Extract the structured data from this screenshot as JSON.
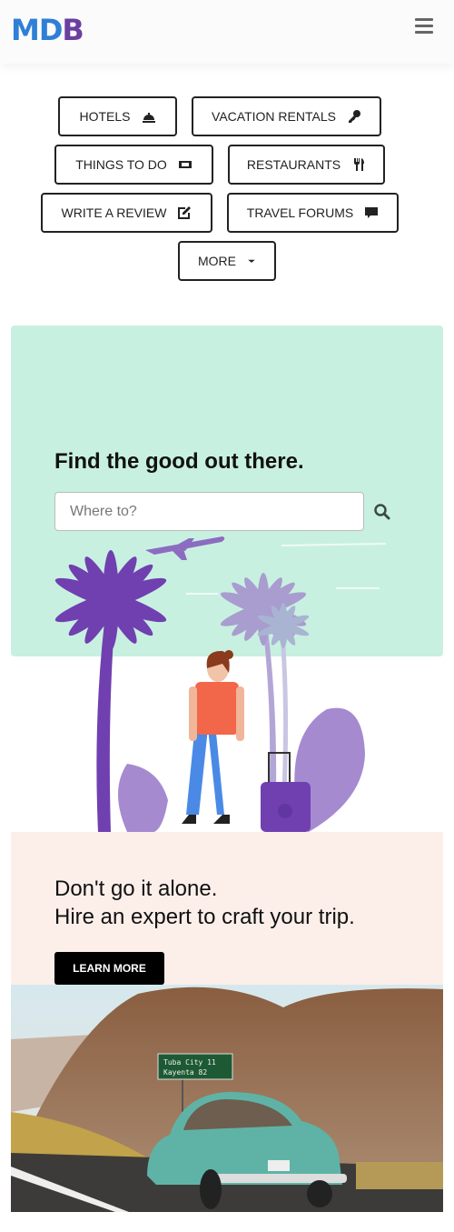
{
  "header": {
    "logo": "MDB",
    "menu_icon": "hamburger-icon"
  },
  "nav_buttons": [
    {
      "label": "HOTELS",
      "icon": "bell-concierge-icon"
    },
    {
      "label": "VACATION RENTALS",
      "icon": "key-icon"
    },
    {
      "label": "THINGS TO DO",
      "icon": "ticket-icon"
    },
    {
      "label": "RESTAURANTS",
      "icon": "utensils-icon"
    },
    {
      "label": "WRITE A REVIEW",
      "icon": "edit-icon"
    },
    {
      "label": "TRAVEL FORUMS",
      "icon": "comment-icon"
    },
    {
      "label": "MORE",
      "icon": "caret-down-icon"
    }
  ],
  "hero": {
    "title": "Find the good out there.",
    "search_placeholder": "Where to?",
    "search_value": "",
    "bg": "#c8f0e1"
  },
  "expert": {
    "line1": "Don't go it alone.",
    "line2": "Hire an expert to craft your trip.",
    "button": "LEARN MORE",
    "bg": "#fcefea"
  },
  "photo": {
    "sign_line1": "Tuba City     11",
    "sign_line2": "Kayenta      82"
  }
}
